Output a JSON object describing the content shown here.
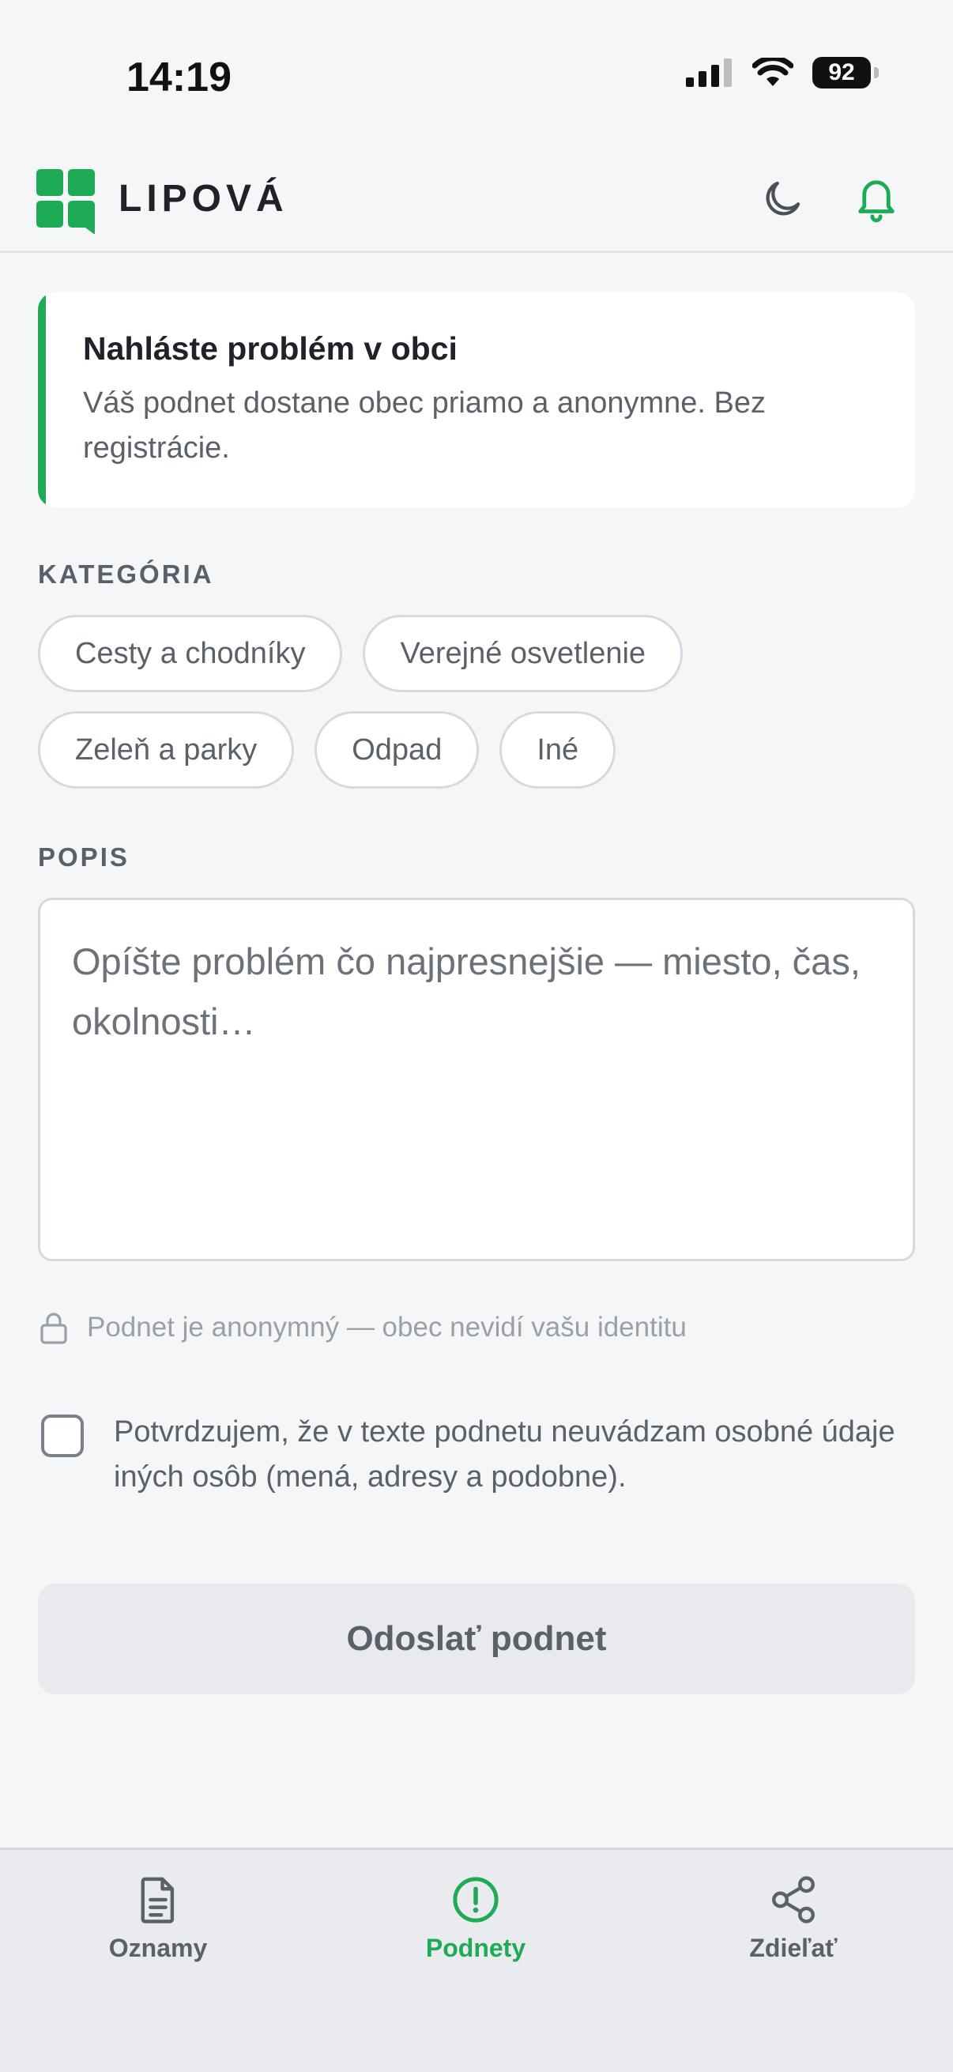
{
  "status_bar": {
    "time": "14:19",
    "battery": "92",
    "icons": [
      "signal-icon",
      "wifi-icon",
      "battery-icon"
    ]
  },
  "header": {
    "title": "LIPOVÁ",
    "logo": "lipova-logo-icon",
    "actions": [
      "moon-icon",
      "bell-icon"
    ],
    "accent_color": "#1faa55"
  },
  "info_card": {
    "title": "Nahláste problém v obci",
    "text": "Váš podnet dostane obec priamo a anonymne. Bez registrácie."
  },
  "category": {
    "label": "KATEGÓRIA",
    "chips": [
      "Cesty a chodníky",
      "Verejné osvetlenie",
      "Zeleň a parky",
      "Odpad",
      "Iné"
    ]
  },
  "description": {
    "label": "POPIS",
    "placeholder": "Opíšte problém čo najpresnejšie — miesto, čas, okolnosti…",
    "value": ""
  },
  "anon_note": {
    "icon": "lock-icon",
    "text": "Podnet je anonymný — obec nevidí vašu identitu"
  },
  "consent": {
    "checked": false,
    "text": "Potvrdzujem, že v texte podnetu neuvádzam osobné údaje iných osôb (mená, adresy a podobne)."
  },
  "submit": {
    "label": "Odoslať podnet"
  },
  "bottom_nav": {
    "items": [
      {
        "label": "Oznamy",
        "icon": "document-icon",
        "active": false
      },
      {
        "label": "Podnety",
        "icon": "alert-circle-icon",
        "active": true
      },
      {
        "label": "Zdieľať",
        "icon": "share-icon",
        "active": false
      }
    ]
  }
}
